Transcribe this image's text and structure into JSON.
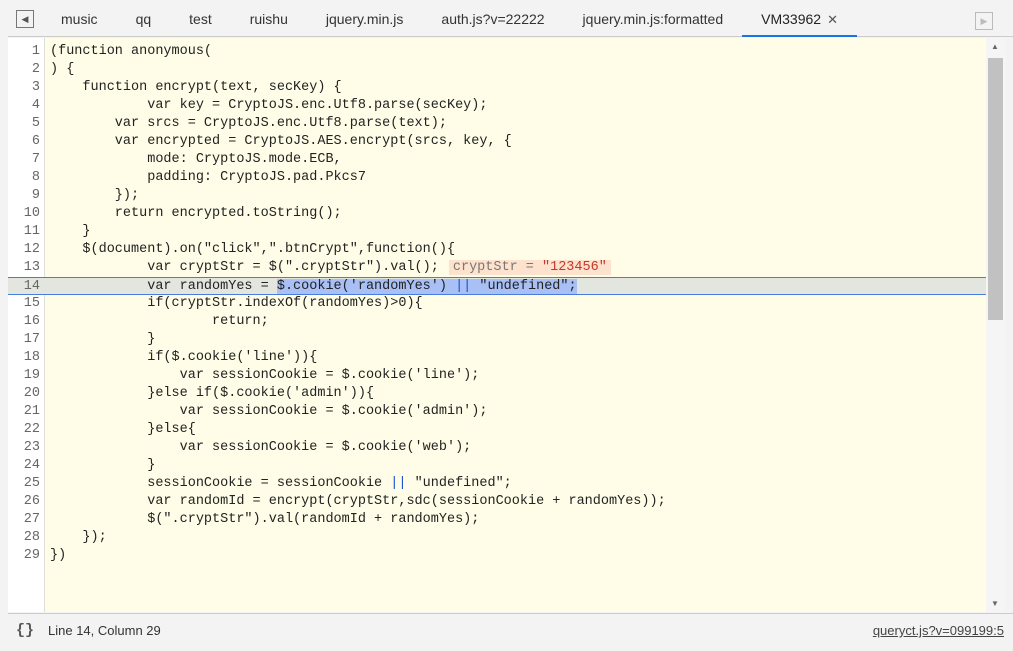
{
  "tabs": [
    {
      "label": "music"
    },
    {
      "label": "qq"
    },
    {
      "label": "test"
    },
    {
      "label": "ruishu"
    },
    {
      "label": "jquery.min.js"
    },
    {
      "label": "auth.js?v=22222"
    },
    {
      "label": "jquery.min.js:formatted"
    },
    {
      "label": "VM33962",
      "active": true,
      "close": "✕"
    }
  ],
  "icons": {
    "toggle_navigator": "sidebar-toggle-icon",
    "toggle_debugger": "sidebar-right-icon",
    "pretty_print": "{}"
  },
  "lines": [
    "(function anonymous(",
    ") {",
    "    function encrypt(text, secKey) {",
    "            var key = CryptoJS.enc.Utf8.parse(secKey);",
    "        var srcs = CryptoJS.enc.Utf8.parse(text);",
    "        var encrypted = CryptoJS.AES.encrypt(srcs, key, {",
    "            mode: CryptoJS.mode.ECB,",
    "            padding: CryptoJS.pad.Pkcs7",
    "        });",
    "        return encrypted.toString();",
    "    }",
    "    $(document).on(\"click\",\".btnCrypt\",function(){",
    "            var cryptStr = $(\".cryptStr\").val();",
    "            var randomYes = $.cookie('randomYes') || \"undefined\";",
    "            if(cryptStr.indexOf(randomYes)>0){",
    "                    return;",
    "            }",
    "            if($.cookie('line')){",
    "                var sessionCookie = $.cookie('line');",
    "            }else if($.cookie('admin')){",
    "                var sessionCookie = $.cookie('admin');",
    "            }else{",
    "                var sessionCookie = $.cookie('web');",
    "            }",
    "            sessionCookie = sessionCookie || \"undefined\";",
    "            var randomId = encrypt(cryptStr,sdc(sessionCookie + randomYes));",
    "            $(\".cryptStr\").val(randomId + randomYes);",
    "    });",
    "})"
  ],
  "current_line": 14,
  "inline_value": {
    "name": "cryptStr = ",
    "value": "\"123456\"",
    "line": 13
  },
  "status": {
    "position": "Line 14, Column 29",
    "source": "queryct.js?v=099199:5"
  },
  "scroll": {
    "visible_fraction": 0.49,
    "offset_fraction": 0
  }
}
